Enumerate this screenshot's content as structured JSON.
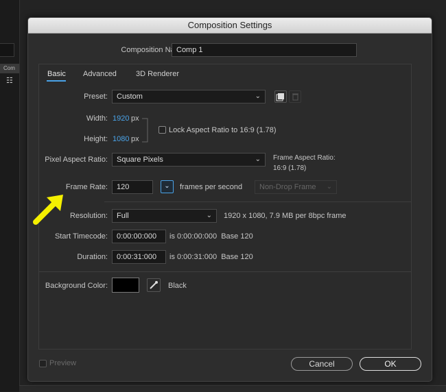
{
  "background": {
    "tab_label": "Com"
  },
  "dialog": {
    "title": "Composition Settings"
  },
  "comp_name": {
    "label": "Composition Name:",
    "value": "Comp 1"
  },
  "tabs": [
    {
      "label": "Basic",
      "active": true
    },
    {
      "label": "Advanced",
      "active": false
    },
    {
      "label": "3D Renderer",
      "active": false
    }
  ],
  "preset": {
    "label": "Preset:",
    "value": "Custom"
  },
  "width": {
    "label": "Width:",
    "value": "1920",
    "unit": "px"
  },
  "height": {
    "label": "Height:",
    "value": "1080",
    "unit": "px"
  },
  "lock_aspect": {
    "label": "Lock Aspect Ratio to 16:9 (1.78)",
    "checked": false
  },
  "pixel_aspect": {
    "label": "Pixel Aspect Ratio:",
    "value": "Square Pixels"
  },
  "frame_aspect": {
    "label": "Frame Aspect Ratio:",
    "value": "16:9 (1.78)"
  },
  "frame_rate": {
    "label": "Frame Rate:",
    "value": "120",
    "unit": "frames per second",
    "drop_frame": "Non-Drop Frame"
  },
  "resolution": {
    "label": "Resolution:",
    "value": "Full",
    "info": "1920 x 1080, 7.9 MB per 8bpc frame"
  },
  "start_timecode": {
    "label": "Start Timecode:",
    "value": "0:00:00:000",
    "info": "is 0:00:00:000  Base 120"
  },
  "duration": {
    "label": "Duration:",
    "value": "0:00:31:000",
    "info": "is 0:00:31:000  Base 120"
  },
  "bg_color": {
    "label": "Background Color:",
    "color": "#000000",
    "name": "Black"
  },
  "footer": {
    "preview_label": "Preview",
    "cancel_label": "Cancel",
    "ok_label": "OK"
  },
  "colors": {
    "accent": "#4aa3e8",
    "annotation_arrow": "#f5f000"
  }
}
